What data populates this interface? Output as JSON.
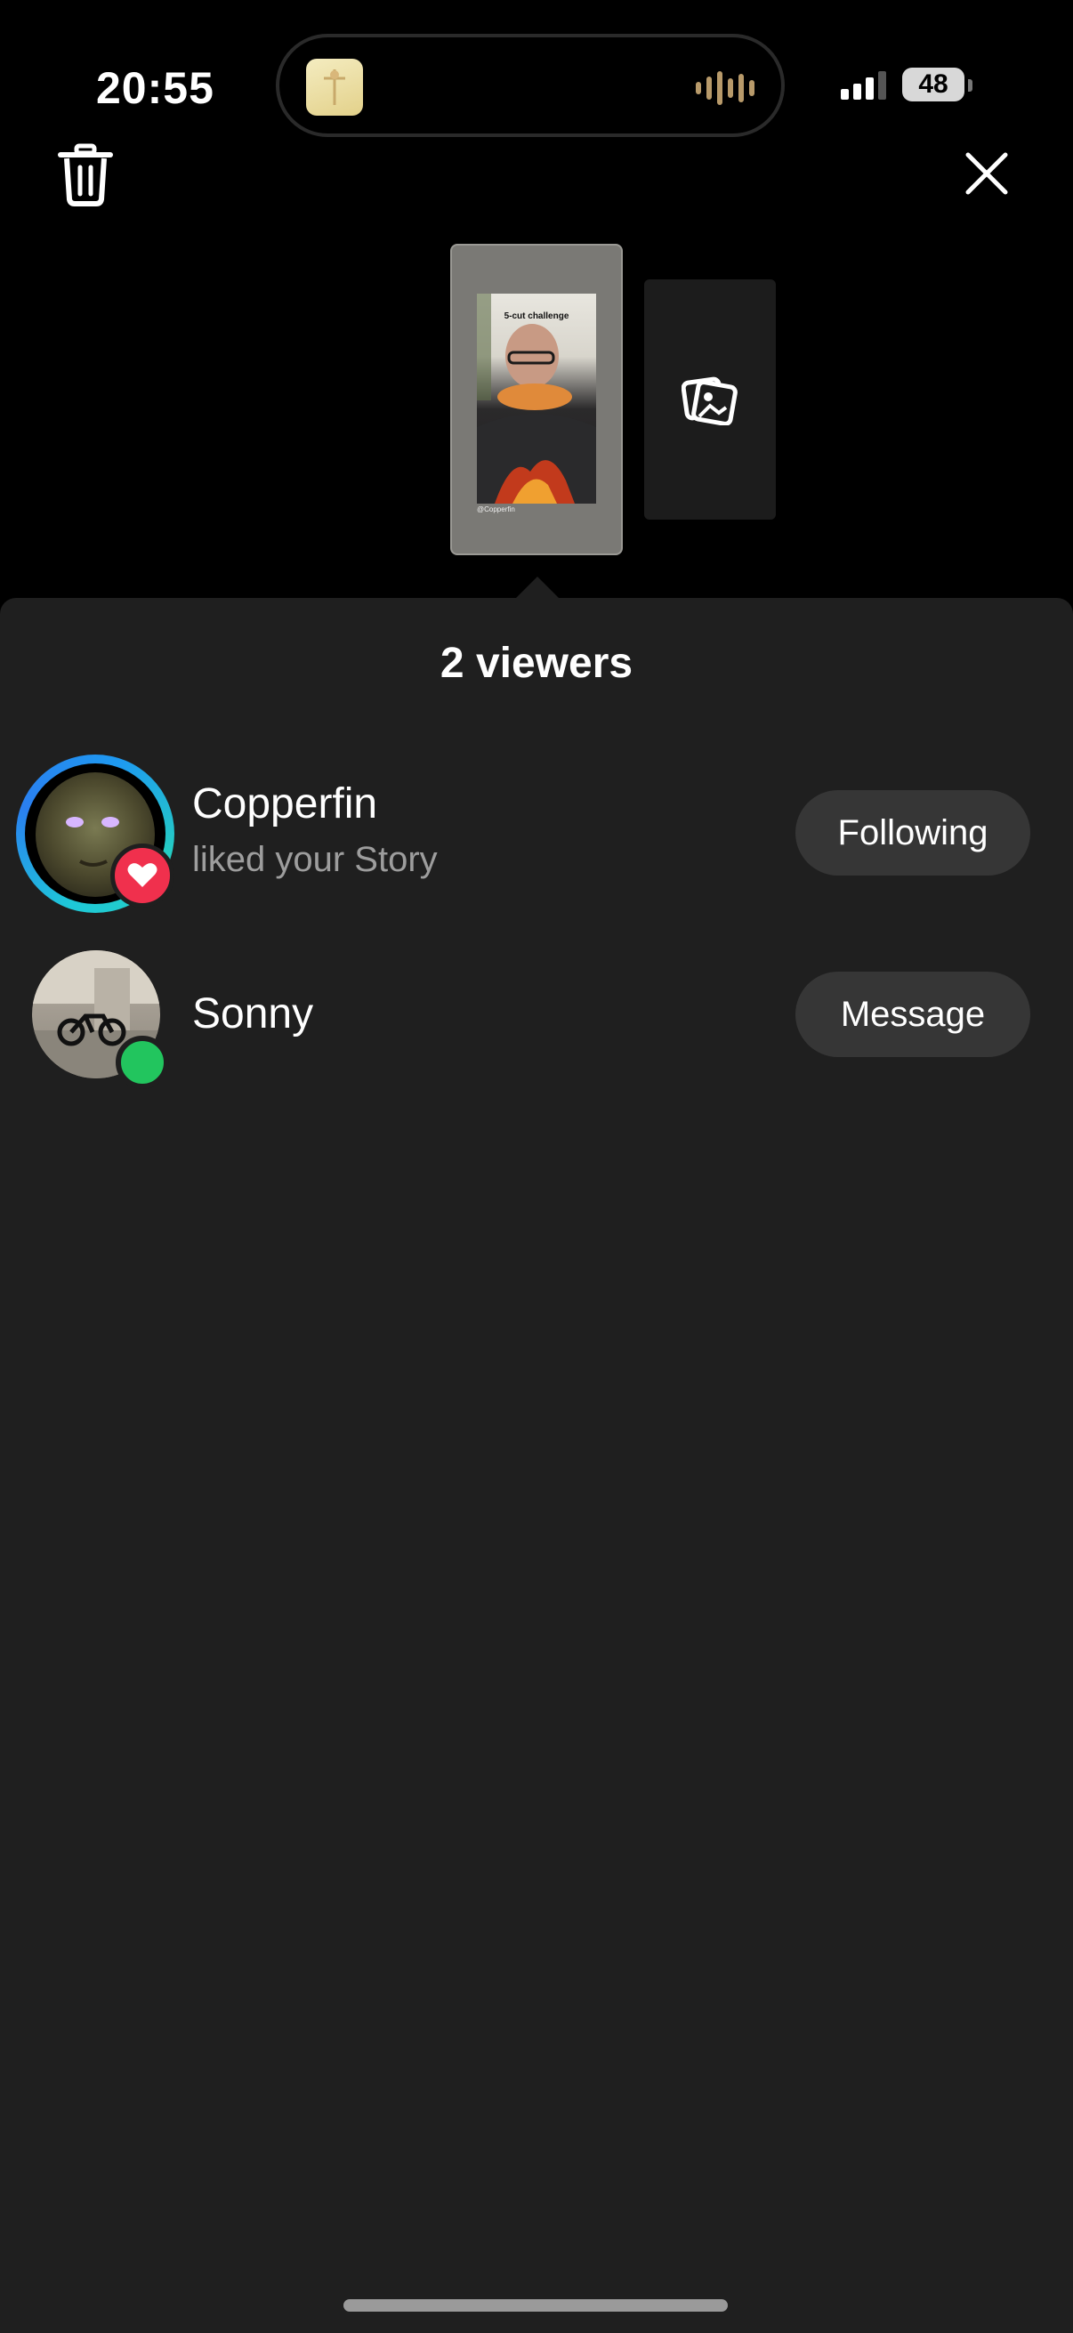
{
  "status_bar": {
    "time": "20:55",
    "battery": "48"
  },
  "story": {
    "caption": "5-cut challenge",
    "handle": "@Copperfin"
  },
  "sheet": {
    "title": "2 viewers"
  },
  "viewers": [
    {
      "name": "Copperfin",
      "subtitle": "liked your Story",
      "action": "Following"
    },
    {
      "name": "Sonny",
      "subtitle": "",
      "action": "Message"
    }
  ],
  "icons": {
    "delete": "trash-icon",
    "close": "close-icon",
    "add_media": "photo-stack-icon",
    "like_badge": "heart-icon"
  },
  "colors": {
    "sheet_bg": "#1f1f1f",
    "pill_bg": "#363636",
    "like_red": "#f0304d",
    "online_green": "#22c55e",
    "story_ring": "#1e9af0"
  }
}
